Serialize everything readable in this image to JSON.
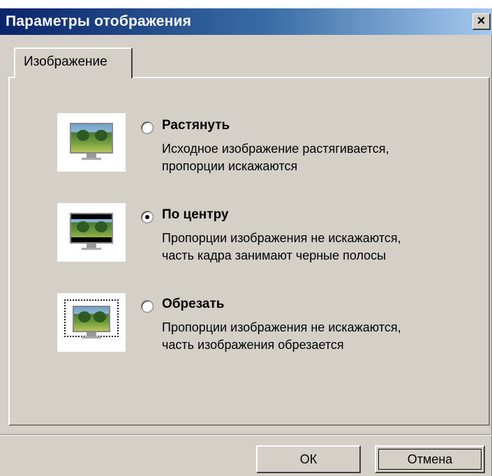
{
  "window": {
    "title": "Параметры отображения",
    "close_glyph": "×"
  },
  "tabs": [
    {
      "label": "Изображение",
      "active": true
    }
  ],
  "options": [
    {
      "label": "Растянуть",
      "description_line1": "Исходное изображение растягивается,",
      "description_line2": "пропорции искажаются",
      "selected": false,
      "icon": "stretch-monitor-icon"
    },
    {
      "label": "По центру",
      "description_line1": "Пропорции изображения не искажаются,",
      "description_line2": "часть кадра занимают черные полосы",
      "selected": true,
      "icon": "center-monitor-icon"
    },
    {
      "label": "Обрезать",
      "description_line1": "Пропорции изображения не искажаются,",
      "description_line2": "часть изображения обрезается",
      "selected": false,
      "icon": "crop-monitor-icon"
    }
  ],
  "buttons": {
    "ok_label": "ОК",
    "cancel_label": "Отмена"
  },
  "colors": {
    "title_start": "#0a246a",
    "title_end": "#a6caf0",
    "face": "#d4d0c8"
  }
}
